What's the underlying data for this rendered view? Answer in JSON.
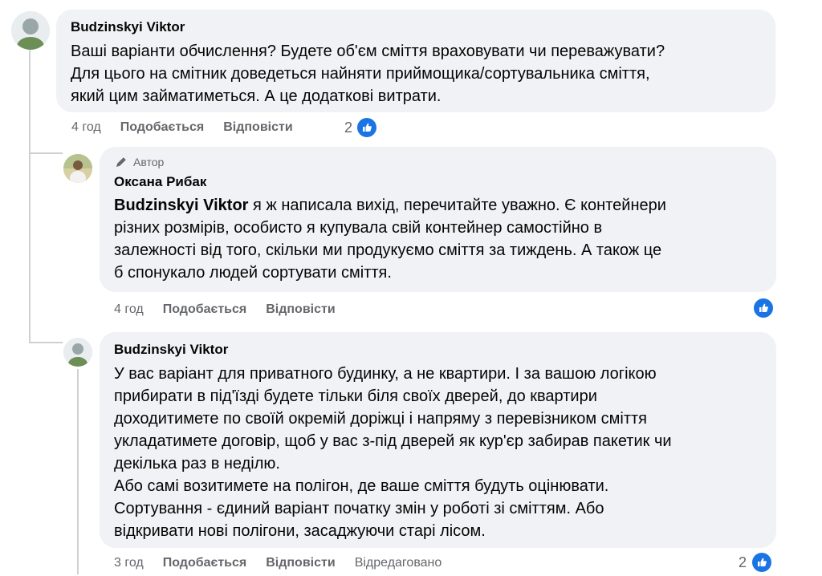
{
  "comments": [
    {
      "author": "Budzinskyi Viktor",
      "text": "Ваші варіанти обчислення? Будете об'єм сміття враховувати чи переважувати?\nДля цього на смітник доведеться найняти приймощика/сортувальника сміття,\nякий цим займатиметься. А це додаткові витрати.",
      "time": "4 год",
      "like_label": "Подобається",
      "reply_label": "Відповісти",
      "reactions": "2"
    },
    {
      "badge": "Автор",
      "author": "Оксана Рибак",
      "mention": "Budzinskyi Viktor",
      "text": " я ж написала вихід, перечитайте уважно. Є контейнери\nрізних розмірів, особисто я купувала свій контейнер самостійно в\nзалежності від того, скільки ми продукуємо сміття за тиждень. А також це\nб спонукало людей сортувати сміття.",
      "time": "4 год",
      "like_label": "Подобається",
      "reply_label": "Відповісти"
    },
    {
      "author": "Budzinskyi Viktor",
      "text": "У вас варіант для приватного будинку, а не квартири. І за вашою логікою\nприбирати в під'їзді будете тільки біля своїх дверей, до квартири\nдоходитимете по своїй окремій доріжці і напряму з перевізником сміття\nукладатимете договір, щоб у вас з-під дверей як кур'єр забирав пакетик чи\nдекілька раз в неділю.\nАбо самі возитимете на полігон, де ваше сміття будуть оцінювати.\nСортування - єдиний варіант початку змін у роботі зі сміттям. Або\nвідкривати нові полігони, засаджуючи старі лісом.",
      "time": "3 год",
      "like_label": "Подобається",
      "reply_label": "Відповісти",
      "edited_label": "Відредаговано",
      "reactions": "2"
    }
  ],
  "icons": {
    "like": "like-icon",
    "author_badge": "pen-icon"
  },
  "colors": {
    "bubble": "#f0f2f5",
    "meta_text": "#65676b",
    "like_blue": "#1b74e4",
    "thread_line": "#ced0d4"
  }
}
